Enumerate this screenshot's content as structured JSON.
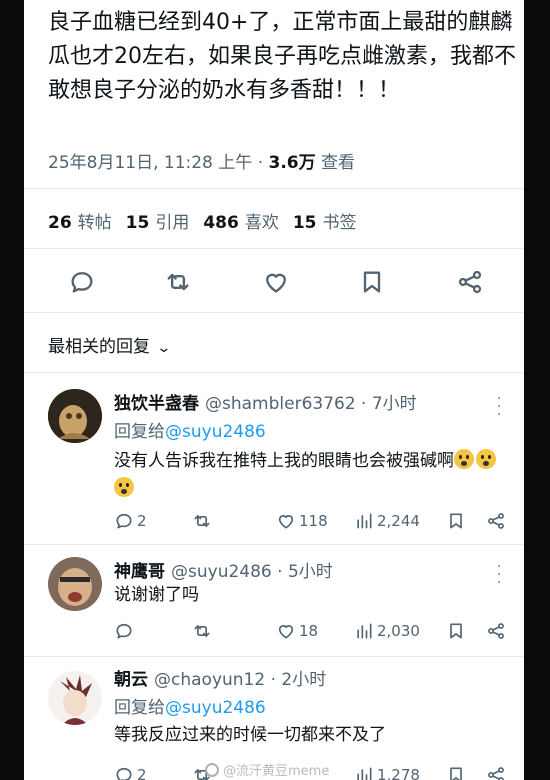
{
  "post": {
    "text": "良子血糖已经到40+了，正常市面上最甜的麒麟瓜也才20左右，如果良子再吃点雌激素，我都不敢想良子分泌的奶水有多香甜！！！",
    "time": "25年8月11日, 11:28 上午",
    "sep": "·",
    "views_count": "3.6万",
    "views_label": "查看"
  },
  "stats": {
    "retweets_count": "26",
    "retweets_label": "转帖",
    "quotes_count": "15",
    "quotes_label": "引用",
    "likes_count": "486",
    "likes_label": "喜欢",
    "bookmarks_count": "15",
    "bookmarks_label": "书签"
  },
  "sort": {
    "label": "最相关的回复",
    "chevron": "v"
  },
  "replies": [
    {
      "name": "独饮半盏春",
      "handle": "@shambler63762 · 7小时",
      "reply_to_label": "回复给",
      "reply_to_handle": "@suyu2486",
      "text": "没有人告诉我在推特上我的眼睛也会被强碱啊",
      "emoji_count": 3,
      "replies": "2",
      "likes": "118",
      "views": "2,244"
    },
    {
      "name": "神鹰哥",
      "handle": "@suyu2486 · 5小时",
      "text": "说谢谢了吗",
      "replies": "",
      "likes": "18",
      "views": "2,030"
    },
    {
      "name": "朝云",
      "handle": "@chaoyun12 · 2小时",
      "reply_to_label": "回复给",
      "reply_to_handle": "@suyu2486",
      "text": "等我反应过来的时候一切都来不及了",
      "replies": "2",
      "views": "1,278"
    }
  ],
  "watermark": "@流汗黄豆meme",
  "colors": {
    "text": "#0f1419",
    "secondary": "#536471",
    "link": "#1d9bf0",
    "divider": "#e6e9eb"
  },
  "icons": [
    "reply-icon",
    "retweet-icon",
    "like-icon",
    "bookmark-icon",
    "share-icon",
    "views-icon",
    "more-icon"
  ]
}
